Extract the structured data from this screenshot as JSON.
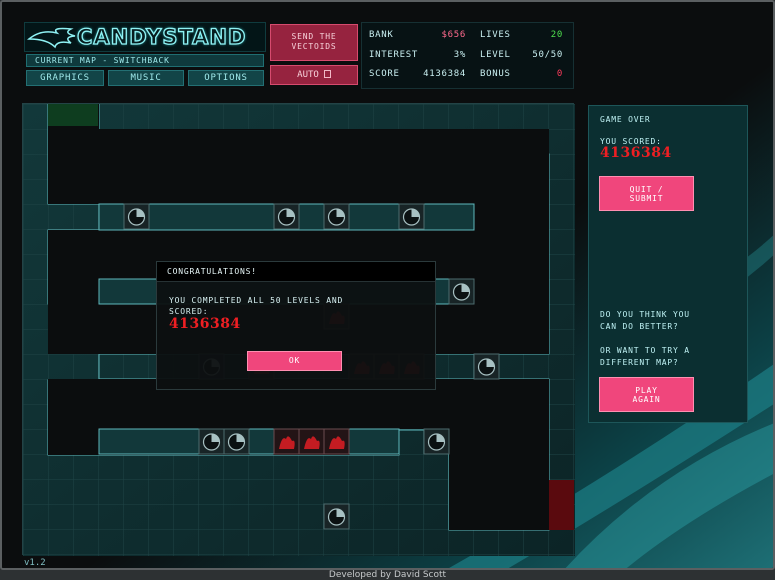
{
  "header": {
    "logo_text": "CANDYSTAND",
    "current_map": "CURRENT MAP - SWITCHBACK",
    "buttons": {
      "graphics": "GRAPHICS",
      "music": "MUSIC",
      "options": "OPTIONS"
    },
    "send_button": [
      "SEND THE",
      "VECTOIDS"
    ],
    "auto_label": "AUTO"
  },
  "stats": {
    "bank_label": "BANK",
    "bank_value": "$656",
    "lives_label": "LIVES",
    "lives_value": "20",
    "interest_label": "INTEREST",
    "interest_value": "3%",
    "level_label": "LEVEL",
    "level_value": "50/50",
    "score_label": "SCORE",
    "score_value": "4136384",
    "bonus_label": "BONUS",
    "bonus_value": "0"
  },
  "side_panel": {
    "title": "GAME OVER",
    "you_scored": "YOU SCORED:",
    "score": "4136384",
    "quit_button": [
      "QUIT /",
      "SUBMIT"
    ],
    "question1": [
      "DO YOU THINK YOU",
      "CAN DO BETTER?"
    ],
    "question2": [
      "OR WANT TO TRY A",
      "DIFFERENT MAP?"
    ],
    "play_button": [
      "PLAY",
      "AGAIN"
    ]
  },
  "dialog": {
    "title": "CONGRATULATIONS!",
    "message": [
      "YOU COMPLETED ALL 50 LEVELS AND",
      "SCORED:"
    ],
    "score": "4136384",
    "ok_label": "OK"
  },
  "footer": {
    "version": "v1.2",
    "credit": "Developed by David Scott"
  },
  "colors": {
    "accent": "#9fe8ea",
    "pink": "#f0467c",
    "score_red": "#ee1f23",
    "path": "#0b0d0e"
  }
}
